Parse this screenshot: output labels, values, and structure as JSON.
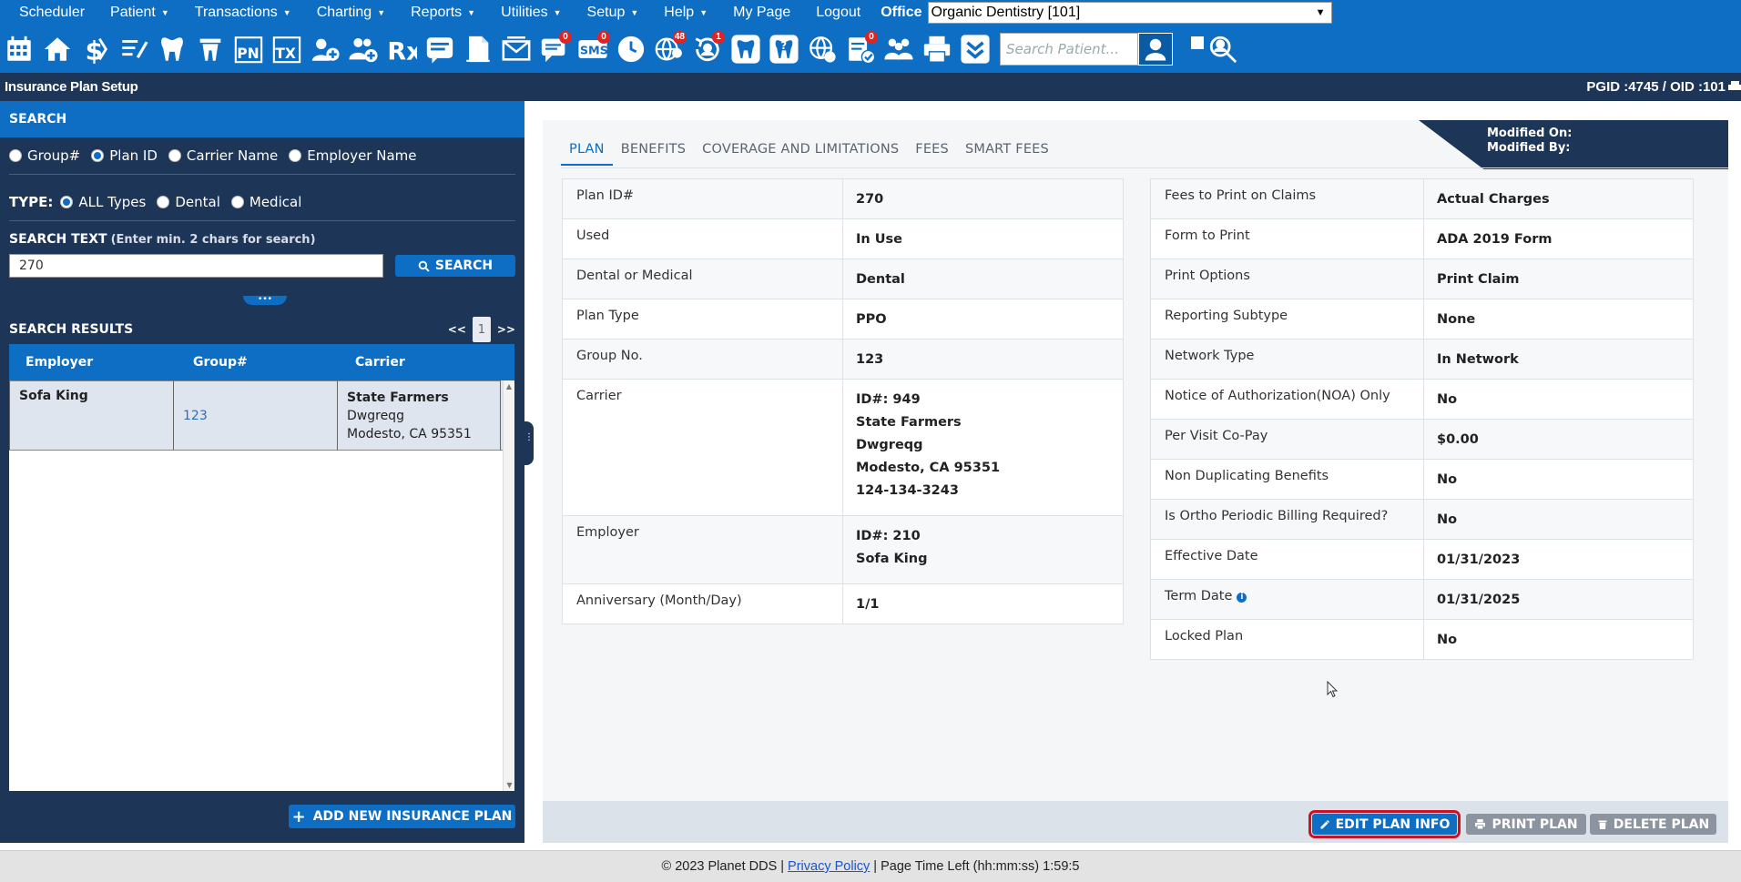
{
  "menu": {
    "items": [
      {
        "label": "Scheduler",
        "caret": false
      },
      {
        "label": "Patient",
        "caret": true
      },
      {
        "label": "Transactions",
        "caret": true
      },
      {
        "label": "Charting",
        "caret": true
      },
      {
        "label": "Reports",
        "caret": true
      },
      {
        "label": "Utilities",
        "caret": true
      },
      {
        "label": "Setup",
        "caret": true
      },
      {
        "label": "Help",
        "caret": true
      },
      {
        "label": "My Page",
        "caret": false
      },
      {
        "label": "Logout",
        "caret": false
      }
    ],
    "office_label": "Office",
    "office_value": "Organic Dentistry [101]"
  },
  "toolbar": {
    "badges": {
      "messages": "0",
      "sms": "0",
      "globe": "48",
      "recall": "1",
      "tasks": "0"
    },
    "sms_label": "SMS",
    "pn_label": "PN",
    "tx_label": "TX",
    "rx_label": "Rx",
    "search_placeholder": "Search Patient..."
  },
  "titlebar": {
    "title": "Insurance Plan Setup",
    "ids": "PGID :4745  /  OID :101"
  },
  "search": {
    "header": "SEARCH",
    "by_options": [
      "Group#",
      "Plan ID",
      "Carrier Name",
      "Employer Name"
    ],
    "by_selected": "Plan ID",
    "type_label": "TYPE:",
    "type_options": [
      "ALL Types",
      "Dental",
      "Medical"
    ],
    "type_selected": "ALL Types",
    "text_label": "SEARCH TEXT",
    "text_hint": "(Enter min. 2 chars for search)",
    "text_value": "270",
    "button": "SEARCH"
  },
  "results": {
    "header": "SEARCH RESULTS",
    "prev": "<<",
    "page": "1",
    "next": ">>",
    "columns": [
      "Employer",
      "Group#",
      "Carrier"
    ],
    "rows": [
      {
        "employer": "Sofa King",
        "group": "123",
        "carrier_name": "State Farmers",
        "carrier_line2": "Dwgreqg",
        "carrier_line3": "Modesto, CA 95351"
      }
    ],
    "add_button": "ADD NEW INSURANCE PLAN"
  },
  "tabs": [
    "PLAN",
    "BENEFITS",
    "COVERAGE AND LIMITATIONS",
    "FEES",
    "SMART FEES"
  ],
  "active_tab": "PLAN",
  "modified": {
    "on_label": "Modified On:",
    "by_label": "Modified By:"
  },
  "plan_left": [
    {
      "key": "Plan ID#",
      "lines": [
        "270"
      ]
    },
    {
      "key": "Used",
      "lines": [
        "In Use"
      ]
    },
    {
      "key": "Dental or Medical",
      "lines": [
        "Dental"
      ]
    },
    {
      "key": "Plan Type",
      "lines": [
        "PPO"
      ]
    },
    {
      "key": "Group No.",
      "lines": [
        "123"
      ]
    },
    {
      "key": "Carrier",
      "lines": [
        "ID#: 949",
        "State Farmers",
        "Dwgreqg",
        "Modesto, CA 95351",
        "124-134-3243"
      ]
    },
    {
      "key": "Employer",
      "lines": [
        "ID#: 210",
        "Sofa King"
      ]
    },
    {
      "key": "Anniversary (Month/Day)",
      "lines": [
        "1/1"
      ]
    }
  ],
  "plan_right": [
    {
      "key": "Fees to Print on Claims",
      "value": "Actual Charges"
    },
    {
      "key": "Form to Print",
      "value": "ADA 2019 Form"
    },
    {
      "key": "Print Options",
      "value": "Print Claim"
    },
    {
      "key": "Reporting Subtype",
      "value": "None"
    },
    {
      "key": "Network Type",
      "value": "In Network"
    },
    {
      "key": "Notice of Authorization(NOA) Only",
      "value": "No"
    },
    {
      "key": "Per Visit Co-Pay",
      "value": "$0.00"
    },
    {
      "key": "Non Duplicating Benefits",
      "value": "No"
    },
    {
      "key": "Is Ortho Periodic Billing Required?",
      "value": "No"
    },
    {
      "key": "Effective Date",
      "value": "01/31/2023"
    },
    {
      "key": "Term Date",
      "value": "01/31/2025",
      "info": true
    },
    {
      "key": "Locked Plan",
      "value": "No"
    }
  ],
  "actions": {
    "edit": "EDIT PLAN INFO",
    "print": "PRINT PLAN",
    "delete": "DELETE PLAN"
  },
  "footer": {
    "copyright": "© 2023 Planet DDS",
    "privacy": "Privacy Policy",
    "time_left": "Page Time Left (hh:mm:ss) 1:59:5"
  },
  "colors": {
    "brand_blue": "#0d6ec4",
    "navy": "#1d3557",
    "edit_highlight": "#cc1122"
  }
}
